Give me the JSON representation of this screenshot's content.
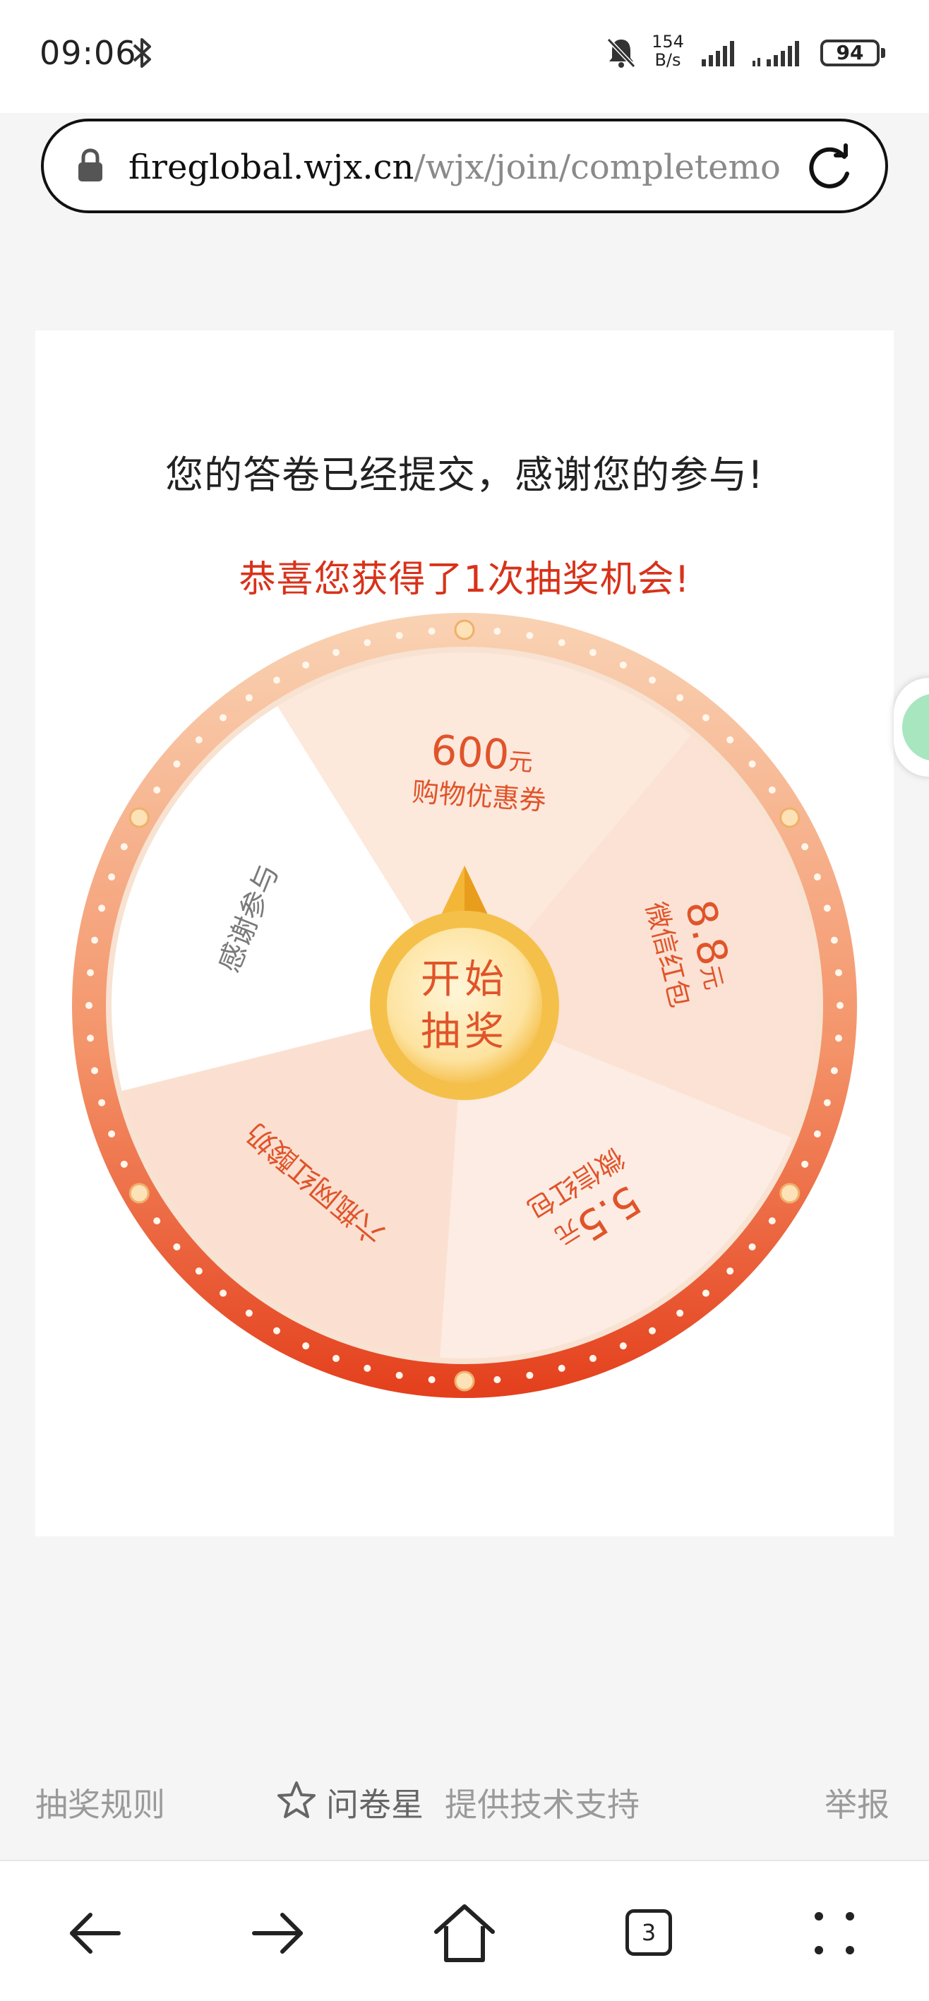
{
  "status_bar": {
    "time": "09:06",
    "net_speed_value": "154",
    "net_speed_unit": "B/s",
    "battery": "94",
    "icons": [
      "bluetooth-icon",
      "mute-bell-icon",
      "signal-icon",
      "signal-icon",
      "battery-icon"
    ]
  },
  "browser": {
    "url_host": "fireglobal.wjx.cn",
    "url_path": "/wjx/join/completemo",
    "icons": [
      "lock-icon",
      "reload-icon"
    ]
  },
  "page": {
    "thanks_message": "您的答卷已经提交，感谢您的参与!",
    "chance_message": "恭喜您获得了1次抽奖机会!",
    "wheel": {
      "start_line1": "开始",
      "start_line2": "抽奖",
      "colors": {
        "rim_top": "#f8c6a0",
        "rim_bottom": "#e8401c",
        "accent_text": "#e0542a",
        "hub": "#f5c04a"
      },
      "segments": [
        {
          "amount": "600",
          "unit": "元",
          "label": "购物优惠券"
        },
        {
          "amount": "8.8",
          "unit": "元",
          "label": "微信红包"
        },
        {
          "amount": "5.5",
          "unit": "元",
          "label": "微信红包"
        },
        {
          "amount": "",
          "unit": "",
          "label": "六瓶网红酸奶"
        },
        {
          "amount": "",
          "unit": "",
          "label": "感谢参与"
        }
      ]
    }
  },
  "footer": {
    "rules": "抽奖规则",
    "brand_name": "问卷星",
    "support": "提供技术支持",
    "report": "举报"
  },
  "bottom_nav": {
    "tab_count": "3",
    "icons": [
      "back-arrow-icon",
      "forward-arrow-icon",
      "home-icon",
      "tabs-icon",
      "menu-dots-icon"
    ]
  }
}
